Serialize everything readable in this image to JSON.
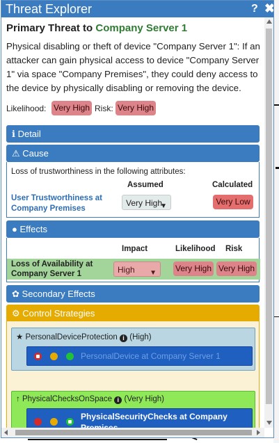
{
  "window": {
    "title": "Threat Explorer",
    "help_glyph": "?",
    "close_glyph": "✖"
  },
  "threat": {
    "heading_prefix": "Primary Threat to",
    "asset": "Company Server 1",
    "description": "Physical disabling or theft of device \"Company Server 1\": If an attacker can gain physical access to device \"Company Server 1\" via space \"Company Premises\", they could deny access to the device by physically disabling or removing the device.",
    "likelihood_label": "Likelihood:",
    "likelihood_value": "Very High",
    "risk_label": "Risk:",
    "risk_value": "Very High"
  },
  "detail": {
    "icon": "info-icon",
    "label": "Detail"
  },
  "cause": {
    "icon": "warning-icon",
    "label": "Cause",
    "intro": "Loss of trustworthiness in the following attributes:",
    "col_assumed": "Assumed",
    "col_calculated": "Calculated",
    "attribute_link": "User Trustworthiness at Company Premises",
    "assumed_value": "Very High",
    "calculated_value": "Very Low"
  },
  "effects": {
    "icon": "droplet-icon",
    "label": "Effects",
    "col_impact": "Impact",
    "col_likelihood": "Likelihood",
    "col_risk": "Risk",
    "row_label": "Loss of Availability at Company Server 1",
    "impact_value": "High",
    "likelihood_value": "Very High",
    "risk_value": "Very High"
  },
  "secondary": {
    "icon": "flame-icon",
    "label": "Secondary Effects"
  },
  "controls": {
    "icon": "gears-icon",
    "label": "Control Strategies",
    "strategies": [
      {
        "icon": "star-icon",
        "name": "PersonalDeviceProtection",
        "level": "(High)",
        "control": "PersonalDevice at Company Server 1"
      },
      {
        "icon": "arrow-up-icon",
        "name": "PhysicalChecksOnSpace",
        "level": "(Very High)",
        "control": "PhysicalSecurityChecks at Company Premises"
      }
    ]
  },
  "colors": {
    "title_bar": "#3b7bbf",
    "asset_green": "#2e7d32",
    "risk_pill": "#dc8489",
    "calculated_pill": "#e46e6e",
    "control_amber": "#e6ab00",
    "strategy1_bg": "#b9d6e2",
    "strategy2_bg": "#8fe858",
    "control_blue": "#1f5fbf"
  }
}
